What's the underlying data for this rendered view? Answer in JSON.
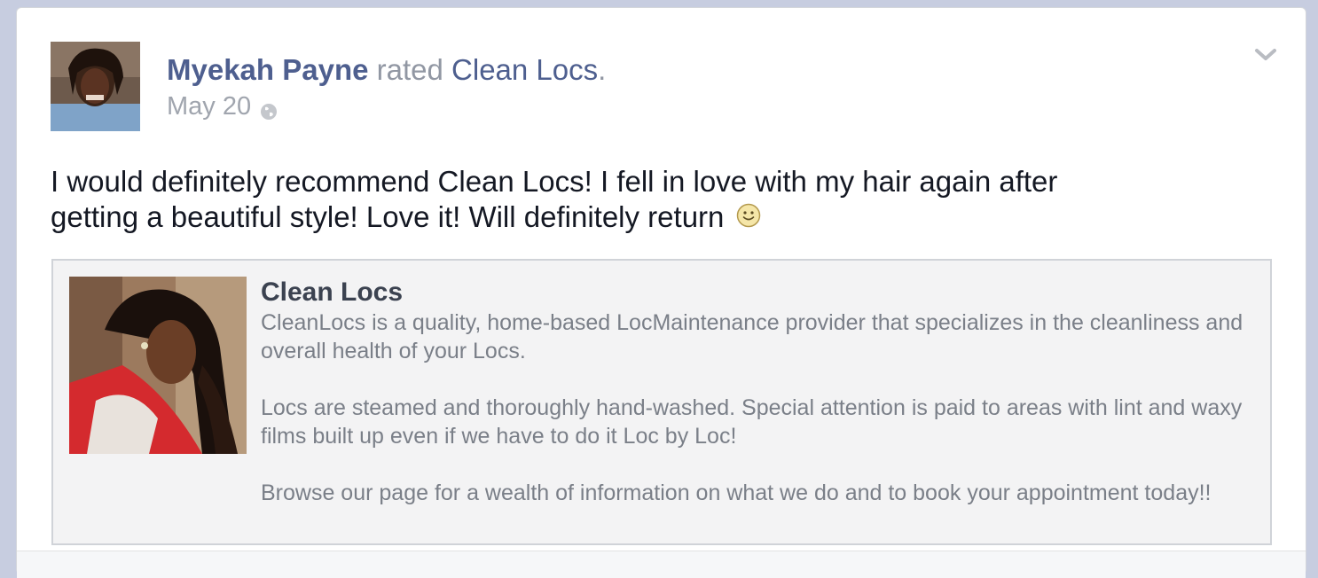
{
  "story": {
    "author": "Myekah Payne",
    "action_text": " rated ",
    "page_name": "Clean Locs",
    "trailing_punct": ".",
    "date": "May 20",
    "privacy_icon": "globe-icon",
    "menu_icon": "chevron-down-icon"
  },
  "post": {
    "text": "I would definitely recommend Clean Locs! I fell in love with my hair again after getting a beautiful style! Love it! Will definitely return",
    "emoji": "smiley-icon"
  },
  "attachment": {
    "title": "Clean Locs",
    "paragraphs": [
      "CleanLocs is a quality, home-based LocMaintenance provider that specializes in the cleanliness and overall health of your Locs.",
      "Locs are steamed and thoroughly hand-washed. Special attention is paid to areas with lint and waxy films built up even if we have to do it Loc by Loc!",
      "Browse our page for a wealth of information on what we do and to book your appointment today!!"
    ]
  },
  "colors": {
    "link": "#4e5f8f",
    "meta": "#a0a5ae",
    "body_text": "#141823",
    "attachment_bg": "#f3f3f4",
    "page_bg": "#c7cde0"
  }
}
